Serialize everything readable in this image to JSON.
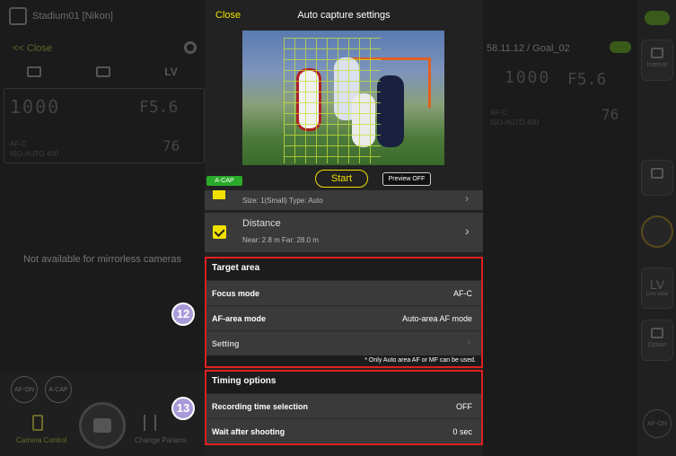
{
  "left_panel": {
    "title": "Stadium01 [Nikon]",
    "close_link": "<< Close",
    "tabs": [
      {
        "label": ""
      },
      {
        "label": ""
      },
      {
        "label": "LV"
      }
    ],
    "lcd": {
      "shutter": "1000",
      "aperture": "F5.6",
      "mode": "AF-C",
      "iso": "ISO-AUTO 400",
      "count": "76"
    },
    "not_available": "Not available for mirrorless cameras",
    "buttons": [
      {
        "label": "AF-ON"
      },
      {
        "label": "A-CAP"
      }
    ],
    "nav": {
      "camera_control": "Camera Control",
      "change_params": "Change Params"
    }
  },
  "right_panel": {
    "header": "58.11.12 / Goal_02",
    "lcd": {
      "shutter": "1000",
      "aperture": "F5.6",
      "mode": "AF-C",
      "iso": "ISO-AUTO 400",
      "count": "76"
    },
    "sidebar": {
      "interval": "Interval",
      "lv": "LV",
      "lv_sub": "Live view",
      "option": "Option",
      "af_on": "AF-ON"
    }
  },
  "modal": {
    "close_label": "Close",
    "title": "Auto capture settings",
    "acap_badge": "A-CAP",
    "start_label": "Start",
    "preview_label": "Preview OFF",
    "size_row": "Size: 1(Small)  Type: Auto",
    "distance": {
      "name": "Distance",
      "values": "Near: 2.8 m  Far: 28.0 m"
    },
    "target_area": {
      "header": "Target area",
      "rows": [
        {
          "label": "Focus mode",
          "value": "AF-C"
        },
        {
          "label": "AF-area mode",
          "value": "Auto-area AF mode"
        },
        {
          "label": "Setting",
          "value": ""
        }
      ],
      "note": "* Only Auto area AF or MF can be used."
    },
    "timing_options": {
      "header": "Timing options",
      "rows": [
        {
          "label": "Recording time selection",
          "value": "OFF"
        },
        {
          "label": "Wait after shooting",
          "value": "0 sec"
        }
      ]
    }
  },
  "callouts": {
    "target_area": "12",
    "timing_options": "13"
  },
  "colors": {
    "accent_yellow": "#f0e000",
    "highlight_red": "#e02020",
    "badge_purple": "#a89ad8",
    "acap_green": "#2aaa2a"
  }
}
